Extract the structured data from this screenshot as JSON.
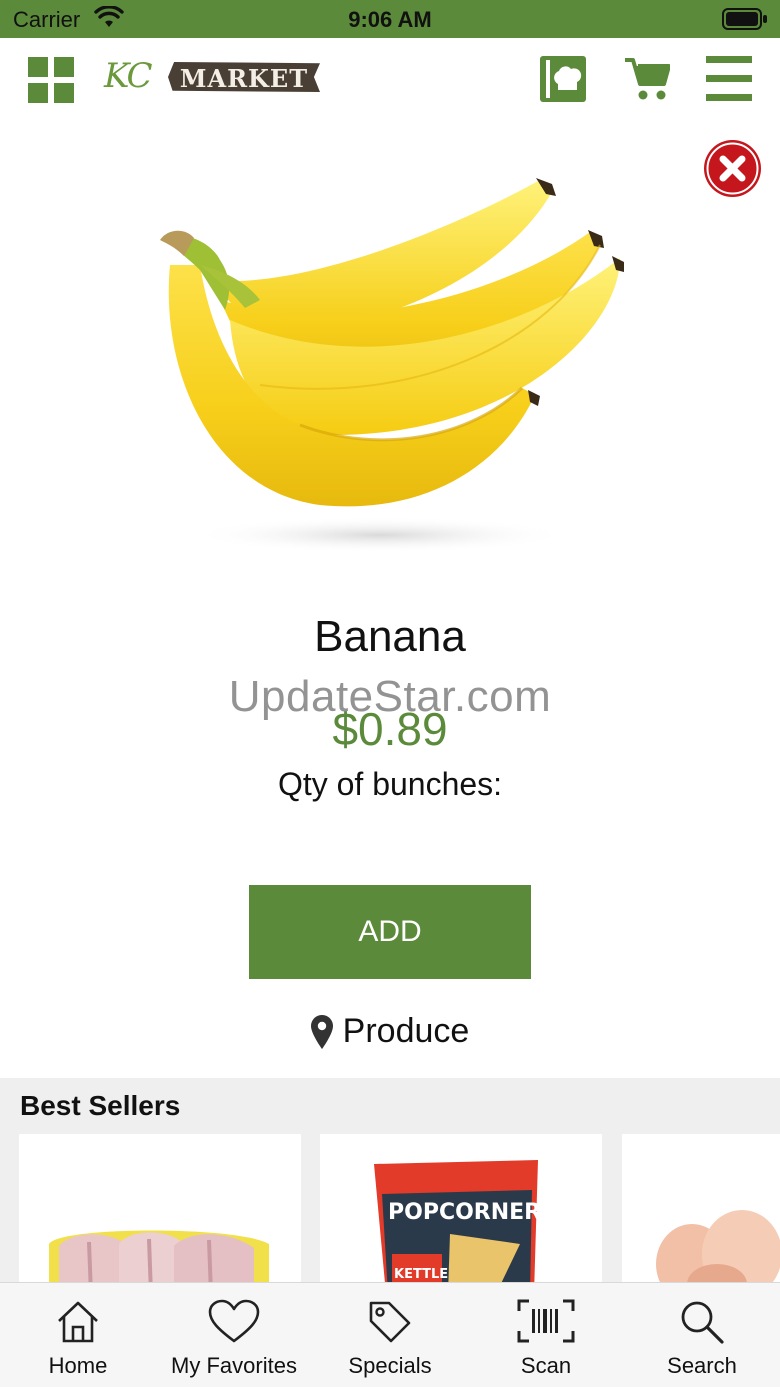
{
  "status_bar": {
    "carrier": "Carrier",
    "time": "9:06 AM"
  },
  "header": {
    "logo_initials": "KC",
    "logo_word": "MARKET",
    "icons": [
      "grid-icon",
      "recipe-icon",
      "cart-icon",
      "menu-icon"
    ]
  },
  "product": {
    "name": "Banana",
    "price": "$0.89",
    "qty_label": "Qty of bunches:",
    "add_label": "ADD",
    "location": "Produce",
    "image": "banana-bunch-image"
  },
  "watermark": "UpdateStar.com",
  "best_sellers": {
    "title": "Best Sellers",
    "items": [
      {
        "image": "chicken-thighs-tray-image"
      },
      {
        "image": "popcorners-bag-image",
        "brand_text": "POPCORNERS",
        "flavor_text": "KETTLE"
      },
      {
        "image": "chicken-pieces-image"
      }
    ]
  },
  "tabs": [
    {
      "label": "Home",
      "icon": "home-icon"
    },
    {
      "label": "My Favorites",
      "icon": "heart-icon"
    },
    {
      "label": "Specials",
      "icon": "tag-icon"
    },
    {
      "label": "Scan",
      "icon": "barcode-icon"
    },
    {
      "label": "Search",
      "icon": "search-icon"
    }
  ],
  "colors": {
    "brand_green": "#5b8a3a",
    "close_red": "#c4161c",
    "logo_brown": "#4a3f35"
  }
}
